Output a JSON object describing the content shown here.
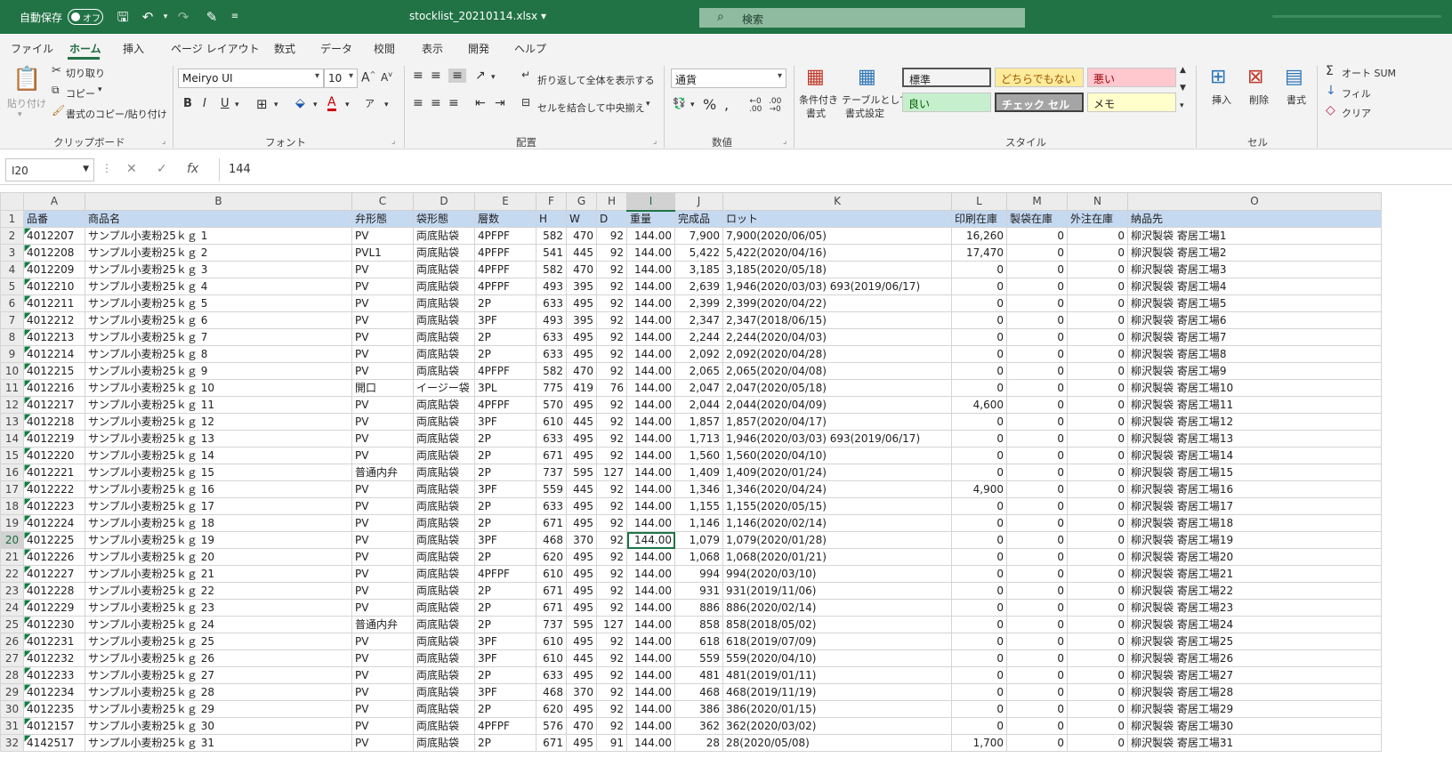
{
  "titlebar": {
    "autosave_label": "自動保存",
    "toggle_state": "オフ",
    "filename": "stocklist_20210114.xlsx ▾",
    "search_placeholder": "検索"
  },
  "menu": [
    "ファイル",
    "ホーム",
    "挿入",
    "ページ レイアウト",
    "数式",
    "データ",
    "校閲",
    "表示",
    "開発",
    "ヘルプ"
  ],
  "ribbon": {
    "clipboard": {
      "paste": "貼り付け",
      "cut": "切り取り",
      "copy": "コピー",
      "format_painter": "書式のコピー/貼り付け",
      "group": "クリップボード"
    },
    "font": {
      "name": "Meiryo UI",
      "size": "10",
      "group": "フォント"
    },
    "alignment": {
      "wrap": "折り返して全体を表示する",
      "merge": "セルを結合して中央揃え",
      "group": "配置"
    },
    "number": {
      "format": "通貨",
      "group": "数値"
    },
    "styles": {
      "conditional": "条件付き",
      "conditional2": "書式",
      "table": "テーブルとして",
      "table2": "書式設定",
      "group": "スタイル",
      "cells": [
        {
          "label": "標準",
          "bg": "#ffffff",
          "color": "#222222"
        },
        {
          "label": "どちらでもない",
          "bg": "#ffeb9c",
          "color": "#9c5700"
        },
        {
          "label": "悪い",
          "bg": "#ffc7ce",
          "color": "#9c0006"
        },
        {
          "label": "良い",
          "bg": "#c6efce",
          "color": "#006100"
        },
        {
          "label": "チェック セル",
          "bg": "#a5a5a5",
          "color": "#ffffff"
        },
        {
          "label": "メモ",
          "bg": "#ffffcc",
          "color": "#222222"
        }
      ]
    },
    "cells": {
      "insert": "挿入",
      "delete": "削除",
      "format": "書式",
      "group": "セル"
    },
    "editing": {
      "autosum": "オート SUM",
      "fill": "フィル",
      "clear": "クリア"
    }
  },
  "formula_bar": {
    "name_box": "I20",
    "value": "144"
  },
  "sheet": {
    "columns": [
      "A",
      "B",
      "C",
      "D",
      "E",
      "F",
      "G",
      "H",
      "I",
      "J",
      "K",
      "L",
      "M",
      "N",
      "O"
    ],
    "selected_column": "I",
    "selected_row": "20",
    "header_row": [
      "品番",
      "商品名",
      "弁形態",
      "袋形態",
      "層数",
      "H",
      "W",
      "D",
      "重量",
      "完成品",
      "ロット",
      "印刷在庫",
      "製袋在庫",
      "外注在庫",
      "納品先"
    ],
    "rows": [
      [
        "2",
        "4012207",
        "サンプル小麦粉25ｋｇ 1",
        "PV",
        "両底貼袋",
        "4PFPF",
        "582",
        "470",
        "92",
        "144.00",
        "7,900",
        "7,900(2020/06/05)",
        "16,260",
        "0",
        "0",
        "柳沢製袋 寄居工場1"
      ],
      [
        "3",
        "4012208",
        "サンプル小麦粉25ｋｇ 2",
        "PVL1",
        "両底貼袋",
        "4PFPF",
        "541",
        "445",
        "92",
        "144.00",
        "5,422",
        "5,422(2020/04/16)",
        "17,470",
        "0",
        "0",
        "柳沢製袋 寄居工場2"
      ],
      [
        "4",
        "4012209",
        "サンプル小麦粉25ｋｇ 3",
        "PV",
        "両底貼袋",
        "4PFPF",
        "582",
        "470",
        "92",
        "144.00",
        "3,185",
        "3,185(2020/05/18)",
        "0",
        "0",
        "0",
        "柳沢製袋 寄居工場3"
      ],
      [
        "5",
        "4012210",
        "サンプル小麦粉25ｋｇ 4",
        "PV",
        "両底貼袋",
        "4PFPF",
        "493",
        "395",
        "92",
        "144.00",
        "2,639",
        "1,946(2020/03/03) 693(2019/06/17)",
        "0",
        "0",
        "0",
        "柳沢製袋 寄居工場4"
      ],
      [
        "6",
        "4012211",
        "サンプル小麦粉25ｋｇ 5",
        "PV",
        "両底貼袋",
        "2P",
        "633",
        "495",
        "92",
        "144.00",
        "2,399",
        "2,399(2020/04/22)",
        "0",
        "0",
        "0",
        "柳沢製袋 寄居工場5"
      ],
      [
        "7",
        "4012212",
        "サンプル小麦粉25ｋｇ 6",
        "PV",
        "両底貼袋",
        "3PF",
        "493",
        "395",
        "92",
        "144.00",
        "2,347",
        "2,347(2018/06/15)",
        "0",
        "0",
        "0",
        "柳沢製袋 寄居工場6"
      ],
      [
        "8",
        "4012213",
        "サンプル小麦粉25ｋｇ 7",
        "PV",
        "両底貼袋",
        "2P",
        "633",
        "495",
        "92",
        "144.00",
        "2,244",
        "2,244(2020/04/03)",
        "0",
        "0",
        "0",
        "柳沢製袋 寄居工場7"
      ],
      [
        "9",
        "4012214",
        "サンプル小麦粉25ｋｇ 8",
        "PV",
        "両底貼袋",
        "2P",
        "633",
        "495",
        "92",
        "144.00",
        "2,092",
        "2,092(2020/04/28)",
        "0",
        "0",
        "0",
        "柳沢製袋 寄居工場8"
      ],
      [
        "10",
        "4012215",
        "サンプル小麦粉25ｋｇ 9",
        "PV",
        "両底貼袋",
        "4PFPF",
        "582",
        "470",
        "92",
        "144.00",
        "2,065",
        "2,065(2020/04/08)",
        "0",
        "0",
        "0",
        "柳沢製袋 寄居工場9"
      ],
      [
        "11",
        "4012216",
        "サンプル小麦粉25ｋｇ 10",
        "開口",
        "イージー袋",
        "3PL",
        "775",
        "419",
        "76",
        "144.00",
        "2,047",
        "2,047(2020/05/18)",
        "0",
        "0",
        "0",
        "柳沢製袋 寄居工場10"
      ],
      [
        "12",
        "4012217",
        "サンプル小麦粉25ｋｇ 11",
        "PV",
        "両底貼袋",
        "4PFPF",
        "570",
        "495",
        "92",
        "144.00",
        "2,044",
        "2,044(2020/04/09)",
        "4,600",
        "0",
        "0",
        "柳沢製袋 寄居工場11"
      ],
      [
        "13",
        "4012218",
        "サンプル小麦粉25ｋｇ 12",
        "PV",
        "両底貼袋",
        "3PF",
        "610",
        "445",
        "92",
        "144.00",
        "1,857",
        "1,857(2020/04/17)",
        "0",
        "0",
        "0",
        "柳沢製袋 寄居工場12"
      ],
      [
        "14",
        "4012219",
        "サンプル小麦粉25ｋｇ 13",
        "PV",
        "両底貼袋",
        "2P",
        "633",
        "495",
        "92",
        "144.00",
        "1,713",
        "1,946(2020/03/03) 693(2019/06/17)",
        "0",
        "0",
        "0",
        "柳沢製袋 寄居工場13"
      ],
      [
        "15",
        "4012220",
        "サンプル小麦粉25ｋｇ 14",
        "PV",
        "両底貼袋",
        "2P",
        "671",
        "495",
        "92",
        "144.00",
        "1,560",
        "1,560(2020/04/10)",
        "0",
        "0",
        "0",
        "柳沢製袋 寄居工場14"
      ],
      [
        "16",
        "4012221",
        "サンプル小麦粉25ｋｇ 15",
        "普通内弁",
        "両底貼袋",
        "2P",
        "737",
        "595",
        "127",
        "144.00",
        "1,409",
        "1,409(2020/01/24)",
        "0",
        "0",
        "0",
        "柳沢製袋 寄居工場15"
      ],
      [
        "17",
        "4012222",
        "サンプル小麦粉25ｋｇ 16",
        "PV",
        "両底貼袋",
        "3PF",
        "559",
        "445",
        "92",
        "144.00",
        "1,346",
        "1,346(2020/04/24)",
        "4,900",
        "0",
        "0",
        "柳沢製袋 寄居工場16"
      ],
      [
        "18",
        "4012223",
        "サンプル小麦粉25ｋｇ 17",
        "PV",
        "両底貼袋",
        "2P",
        "633",
        "495",
        "92",
        "144.00",
        "1,155",
        "1,155(2020/05/15)",
        "0",
        "0",
        "0",
        "柳沢製袋 寄居工場17"
      ],
      [
        "19",
        "4012224",
        "サンプル小麦粉25ｋｇ 18",
        "PV",
        "両底貼袋",
        "2P",
        "671",
        "495",
        "92",
        "144.00",
        "1,146",
        "1,146(2020/02/14)",
        "0",
        "0",
        "0",
        "柳沢製袋 寄居工場18"
      ],
      [
        "20",
        "4012225",
        "サンプル小麦粉25ｋｇ 19",
        "PV",
        "両底貼袋",
        "3PF",
        "468",
        "370",
        "92",
        "144.00",
        "1,079",
        "1,079(2020/01/28)",
        "0",
        "0",
        "0",
        "柳沢製袋 寄居工場19"
      ],
      [
        "21",
        "4012226",
        "サンプル小麦粉25ｋｇ 20",
        "PV",
        "両底貼袋",
        "2P",
        "620",
        "495",
        "92",
        "144.00",
        "1,068",
        "1,068(2020/01/21)",
        "0",
        "0",
        "0",
        "柳沢製袋 寄居工場20"
      ],
      [
        "22",
        "4012227",
        "サンプル小麦粉25ｋｇ 21",
        "PV",
        "両底貼袋",
        "4PFPF",
        "610",
        "495",
        "92",
        "144.00",
        "994",
        "994(2020/03/10)",
        "0",
        "0",
        "0",
        "柳沢製袋 寄居工場21"
      ],
      [
        "23",
        "4012228",
        "サンプル小麦粉25ｋｇ 22",
        "PV",
        "両底貼袋",
        "2P",
        "671",
        "495",
        "92",
        "144.00",
        "931",
        "931(2019/11/06)",
        "0",
        "0",
        "0",
        "柳沢製袋 寄居工場22"
      ],
      [
        "24",
        "4012229",
        "サンプル小麦粉25ｋｇ 23",
        "PV",
        "両底貼袋",
        "2P",
        "671",
        "495",
        "92",
        "144.00",
        "886",
        "886(2020/02/14)",
        "0",
        "0",
        "0",
        "柳沢製袋 寄居工場23"
      ],
      [
        "25",
        "4012230",
        "サンプル小麦粉25ｋｇ 24",
        "普通内弁",
        "両底貼袋",
        "2P",
        "737",
        "595",
        "127",
        "144.00",
        "858",
        "858(2018/05/02)",
        "0",
        "0",
        "0",
        "柳沢製袋 寄居工場24"
      ],
      [
        "26",
        "4012231",
        "サンプル小麦粉25ｋｇ 25",
        "PV",
        "両底貼袋",
        "3PF",
        "610",
        "495",
        "92",
        "144.00",
        "618",
        "618(2019/07/09)",
        "0",
        "0",
        "0",
        "柳沢製袋 寄居工場25"
      ],
      [
        "27",
        "4012232",
        "サンプル小麦粉25ｋｇ 26",
        "PV",
        "両底貼袋",
        "3PF",
        "610",
        "445",
        "92",
        "144.00",
        "559",
        "559(2020/04/10)",
        "0",
        "0",
        "0",
        "柳沢製袋 寄居工場26"
      ],
      [
        "28",
        "4012233",
        "サンプル小麦粉25ｋｇ 27",
        "PV",
        "両底貼袋",
        "2P",
        "633",
        "495",
        "92",
        "144.00",
        "481",
        "481(2019/01/11)",
        "0",
        "0",
        "0",
        "柳沢製袋 寄居工場27"
      ],
      [
        "29",
        "4012234",
        "サンプル小麦粉25ｋｇ 28",
        "PV",
        "両底貼袋",
        "3PF",
        "468",
        "370",
        "92",
        "144.00",
        "468",
        "468(2019/11/19)",
        "0",
        "0",
        "0",
        "柳沢製袋 寄居工場28"
      ],
      [
        "30",
        "4012235",
        "サンプル小麦粉25ｋｇ 29",
        "PV",
        "両底貼袋",
        "2P",
        "620",
        "495",
        "92",
        "144.00",
        "386",
        "386(2020/01/15)",
        "0",
        "0",
        "0",
        "柳沢製袋 寄居工場29"
      ],
      [
        "31",
        "4012157",
        "サンプル小麦粉25ｋｇ 30",
        "PV",
        "両底貼袋",
        "4PFPF",
        "576",
        "470",
        "92",
        "144.00",
        "362",
        "362(2020/03/02)",
        "0",
        "0",
        "0",
        "柳沢製袋 寄居工場30"
      ],
      [
        "32",
        "4142517",
        "サンプル小麦粉25ｋｇ 31",
        "PV",
        "両底貼袋",
        "2P",
        "671",
        "495",
        "91",
        "144.00",
        "28",
        "28(2020/05/08)",
        "1,700",
        "0",
        "0",
        "柳沢製袋 寄居工場31"
      ]
    ]
  }
}
